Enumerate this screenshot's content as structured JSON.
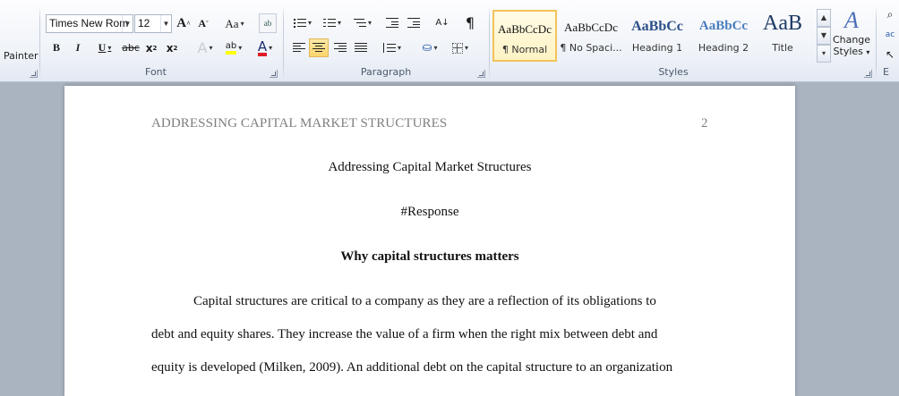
{
  "ribbon": {
    "clipboard": {
      "painter_label": "Painter"
    },
    "font": {
      "group_label": "Font",
      "font_name": "Times New Rom",
      "font_size": "12",
      "grow_label": "A",
      "shrink_label": "A",
      "case_label": "Aa",
      "bold": "B",
      "italic": "I",
      "underline": "U",
      "strike": "abc",
      "subscript": "x",
      "superscript": "x",
      "text_effects": "A",
      "highlight": "ab",
      "font_color": "A",
      "highlight_color": "#ffff00",
      "font_color_value": "#e01b24"
    },
    "paragraph": {
      "group_label": "Paragraph",
      "pilcrow": "¶"
    },
    "styles": {
      "group_label": "Styles",
      "items": [
        {
          "sample": "AaBbCcDc",
          "name": "¶ Normal",
          "selected": true
        },
        {
          "sample": "AaBbCcDc",
          "name": "¶ No Spaci...",
          "selected": false
        },
        {
          "sample": "AaBbCc",
          "name": "Heading 1",
          "selected": false
        },
        {
          "sample": "AaBbCc",
          "name": "Heading 2",
          "selected": false
        },
        {
          "sample": "AaB",
          "name": "Title",
          "selected": false
        }
      ],
      "change_styles_line1": "Change",
      "change_styles_line2": "Styles",
      "editing_cut_label": "E"
    }
  },
  "document": {
    "header_left": "ADDRESSING CAPITAL MARKET STRUCTURES",
    "page_number": "2",
    "title": "Addressing Capital Market Structures",
    "response": "#Response",
    "heading": "Why capital structures matters",
    "paragraph_lines": [
      "Capital structures are critical to a company as they are a reflection of its obligations to",
      "debt and equity shares. They increase the value of a firm when the right mix between debt and",
      "equity is  developed (Milken, 2009). An additional debt on the capital structure to an organization"
    ]
  }
}
